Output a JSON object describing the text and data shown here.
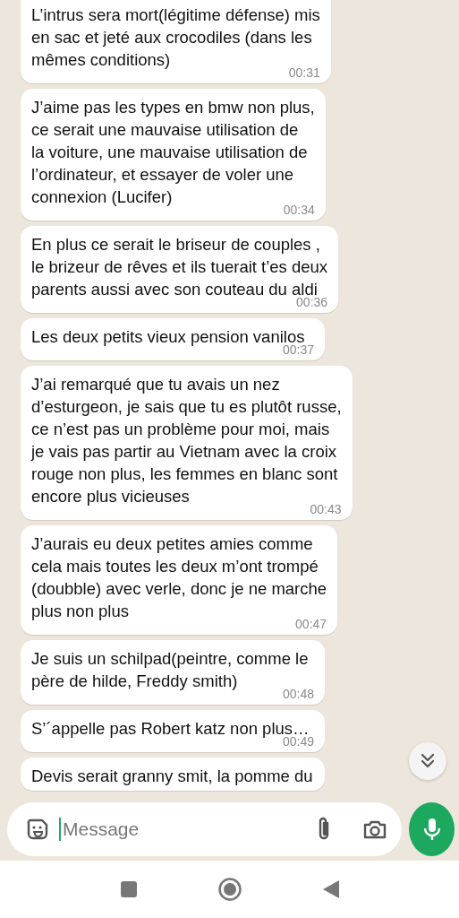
{
  "messages": [
    {
      "text": "L’intrus sera mort(légitime défense) mis\nen sac et jeté aux crocodiles (dans les\nmêmes conditions)",
      "time": "00:31"
    },
    {
      "text": "J’aime pas les types en bmw non plus,\nce serait une mauvaise utilisation de\nla voiture, une mauvaise utilisation de\nl’ordinateur, et essayer de voler une\nconnexion (Lucifer)",
      "time": "00:34"
    },
    {
      "text": "En plus ce serait le briseur de couples ,\nle brizeur de rêves et ils tuerait t’es deux\nparents aussi avec son couteau du aldi",
      "time": "00:36"
    },
    {
      "text": "Les deux petits vieux pension vanilos",
      "time": "00:37"
    },
    {
      "text": "J’ai remarqué que tu avais un nez\nd’esturgeon, je sais que tu es plutôt russe,\nce n’est pas un problème pour moi, mais\nje vais pas partir au Vietnam avec la croix\nrouge non plus, les femmes en blanc sont\nencore plus vicieuses",
      "time": "00:43"
    },
    {
      "text": "J’aurais eu deux petites amies comme\ncela mais toutes les deux m’ont trompé\n(doubble) avec verle, donc je ne marche\nplus non plus",
      "time": "00:47"
    },
    {
      "text": "Je suis un schilpad(peintre, comme le\npère de hilde, Freddy smith)",
      "time": "00:48"
    },
    {
      "text": "S’´appelle pas Robert katz non plus…",
      "time": "00:49"
    },
    {
      "text": "Devis serait granny smit, la pomme du"
    }
  ],
  "composer": {
    "placeholder": "Message"
  }
}
